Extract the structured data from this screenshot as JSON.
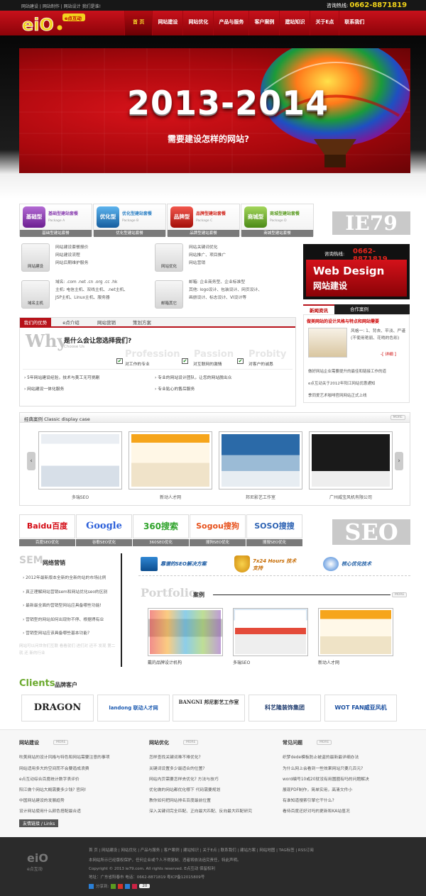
{
  "topbar": {
    "links": "网站建设 | 网站制作 | 网站设计  我们是谁!",
    "hotline_label": "咨询热线:",
    "hotline_number": "0662-8871819"
  },
  "logo": {
    "text": "e点互动"
  },
  "nav": [
    "首 页",
    "网站建设",
    "网站优化",
    "产品与服务",
    "客户案例",
    "建站知识",
    "关于E点",
    "联系我们"
  ],
  "hero": {
    "year": "2013-2014",
    "subtitle": "需要建设怎样的网站?"
  },
  "packages": [
    {
      "badge": "基础型",
      "title": "基础型建站套餐",
      "sub": "Package A",
      "caption": "基础型建站套餐",
      "color": "#8a3fb0"
    },
    {
      "badge": "优化型",
      "title": "优化型建站套餐",
      "sub": "Package B",
      "caption": "优化型建站套餐",
      "color": "#2a7fc4"
    },
    {
      "badge": "品牌型",
      "title": "品牌型建站套餐",
      "sub": "Package C",
      "caption": "品牌型建站套餐",
      "color": "#d0251b"
    },
    {
      "badge": "商城型",
      "title": "商城型建站套餐",
      "sub": "Package D",
      "caption": "商城型建站套餐",
      "color": "#6aa92c"
    }
  ],
  "ie79": "IE79",
  "services": [
    {
      "icon": "网站建设",
      "lines": [
        "网站建设套餐报价",
        "网站建设流程",
        "网站后期维护服务"
      ]
    },
    {
      "icon": "网站优化",
      "lines": [
        "网站关键词优化",
        "网站推广、项目推广",
        "网站营销"
      ]
    },
    {
      "icon": "域名主机",
      "lines": [
        "域名: .com .net .cn .org .cc .hk",
        "主机: 电信主机、双线主机、.net主机、",
        "JSP主机、Linux主机、服务器"
      ]
    },
    {
      "icon": "邮箱其它",
      "lines": [
        "邮箱: 企业商务型、企业标准型",
        "其他: logo设计、包装设计、网页设计、",
        "画册设计、标志设计、VI设计等"
      ]
    }
  ],
  "hotline": {
    "label": "咨询热线:",
    "number": "0662-8871819",
    "en": "Web Design",
    "cn": "网站建设"
  },
  "news": {
    "tabs": [
      "新闻资讯",
      "合作案例"
    ],
    "headline": "做美网站的设计风格与特点和网站需要",
    "feature_text": "风格一: 1、背去、平淡、严谨 (不使用艳丽、花哨的色彩)",
    "more": "-[ 详细 ]",
    "items": [
      "做好网站企业需要提升的最佳和链接工作的道",
      "e点互动关于2012年阳江网站优惠通知",
      "季同爱艺术咖啡官网网站正式上线"
    ]
  },
  "advantages": {
    "tabs": [
      "我们的优势",
      "e点介绍",
      "网站营销",
      "策划方案"
    ],
    "why": "Why",
    "heading": "是什么会让您选择我们?",
    "choose": "Choose Us",
    "pill_words": [
      "Profession",
      "Passion",
      "Probity"
    ],
    "pillars": [
      "对工作的专业",
      "对互联网的激情",
      "对客户的诚恳"
    ],
    "points": [
      "5年网站建设经验，技术与美工无可挑剔",
      "专业的网站设计团队，让您的网站脱出众",
      "网站建设一体化服务",
      "专业贴心的售后服务"
    ]
  },
  "cases": {
    "title": "经典案例  Classic display case",
    "more": "MORE",
    "items": [
      "多瑞SEO",
      "新动人才网",
      "邦尼影艺工作室",
      "广州威宝风机有限公司"
    ]
  },
  "search_engines": [
    {
      "name": "Baidu百度",
      "caption": "百度SEO优化",
      "color": "#d40c16"
    },
    {
      "name": "Google",
      "caption": "谷歌SEO优化",
      "color": "#2b5fd9"
    },
    {
      "name": "360搜索",
      "caption": "360SEO优化",
      "color": "#2fa32b"
    },
    {
      "name": "Sogou搜狗",
      "caption": "搜狗SEO优化",
      "color": "#e7511c"
    },
    {
      "name": "SOSO搜搜",
      "caption": "搜搜SEO优化",
      "color": "#2f64b4"
    }
  ],
  "seo_big": "SEO",
  "sem": {
    "title": "网络营销",
    "items": [
      "2012年最新版本全新的全新的站的市场比例",
      "真正理解网站营销sem和网站优化seo的区别",
      "最新最全面的营销型网站应具备哪些功能!",
      "营销型的网站如何出现你不停、根据得有业",
      "营销型网站应该具备哪些基本功能?"
    ],
    "faded": "网站可以问世你们互联 看看就们 进们对 还不 发现 第二就 还 新的行业"
  },
  "features": [
    "靠谱的SEO解决方案",
    "7x24 Hours 技术支持",
    "核心优化技术"
  ],
  "portfolio": {
    "title": "Portfolio",
    "title_cn": "案例",
    "more": "MORE",
    "items": [
      "戴的品牌设计机构",
      "多瑞SEO",
      "新动人才网"
    ]
  },
  "clients": {
    "title": "Clients",
    "title_cn": "品牌客户",
    "items": [
      "DRAGON",
      "landong 联动人才网",
      "BANGNI 邦尼影艺工作室",
      "科艺隆装饰集团",
      "WOT FAN威亚风机"
    ]
  },
  "footer_cols": [
    {
      "title": "网站建设",
      "more": "MORE",
      "items": [
        "吹美网站的设计风格与特色和网站需要注意的事项",
        "网站适用多大的空间而不会要造成浪费",
        "e点互动综合百度统计数字表评价",
        "阳江做个网站大概需要多少钱? 官网!",
        "中国网站建设的发展趋势",
        "设计网站使用什么颜色搭配最合适"
      ]
    },
    {
      "title": "网站优化",
      "more": "MORE",
      "items": [
        "怎样查找关键词难不难优化?",
        "关键词设置多少最适合的位置?",
        "网站内页需要怎样去优化? 方法与技巧",
        "优化做的网站都优化哪下 代码需要规划",
        "教你如何把网站排名百度最前位置",
        "深入关键词完全匹配、正向最大匹配、反向最大匹配研究"
      ]
    },
    {
      "title": "常见问题",
      "more": "MORE",
      "items": [
        "织梦dede模板防止被盗的最新最详细办法",
        "为什么网上会看到一些效果网站只要几百元?",
        "word编号10或20就没有用圆圈有吗的问题解决",
        "展现PDF制作，简单实用，高清文件小",
        "有谁知道搜索引擎它干什么?",
        "看待百度还好对吗的更新和KA站值况"
      ]
    }
  ],
  "friend_links": "友情链接 / Links",
  "footer": {
    "logo": "e点互动",
    "nav": "首 页 | 网站建设 | 网站优化 | 产品与服务 | 客户案例 | 建站知识 | 关于E点 | 联系我们 | 建站方案 | 网站地图 | TAG标签 | RSS订阅",
    "line1": "本网站所示已经版权保护，任何企业或个人不得复制、违者将依法追究责任，特此声明。",
    "line2": "Copyright © 2013 ie79.com. All rights reserved.  E点互动  保留权利",
    "line3": "地址：广东省阳春市",
    "line4": "电话：0662-8871819   粤ICP备12015809号",
    "share": "分享到:",
    "share_count": "20"
  }
}
